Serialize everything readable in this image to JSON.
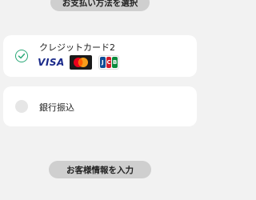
{
  "sections": {
    "payment_method_title": "お支払い方法を選択",
    "customer_info_title": "お客様情報を入力"
  },
  "payment_options": [
    {
      "label": "クレジットカード2",
      "selected": true,
      "brands": [
        {
          "name": "VISA",
          "icon": "visa-logo"
        },
        {
          "name": "Mastercard",
          "icon": "mastercard-logo"
        },
        {
          "name": "JCB",
          "icon": "jcb-logo"
        }
      ]
    },
    {
      "label": "銀行振込",
      "selected": false
    }
  ],
  "colors": {
    "background": "#f2f2f2",
    "pill": "#cfcfcf",
    "check_green": "#2aa877",
    "visa_blue": "#1a2a8a",
    "mc_red": "#eb001b",
    "mc_orange": "#f79e1b",
    "jcb_blue": "#0e4c96",
    "jcb_red": "#d31b2b",
    "jcb_green": "#0a8a3c"
  }
}
